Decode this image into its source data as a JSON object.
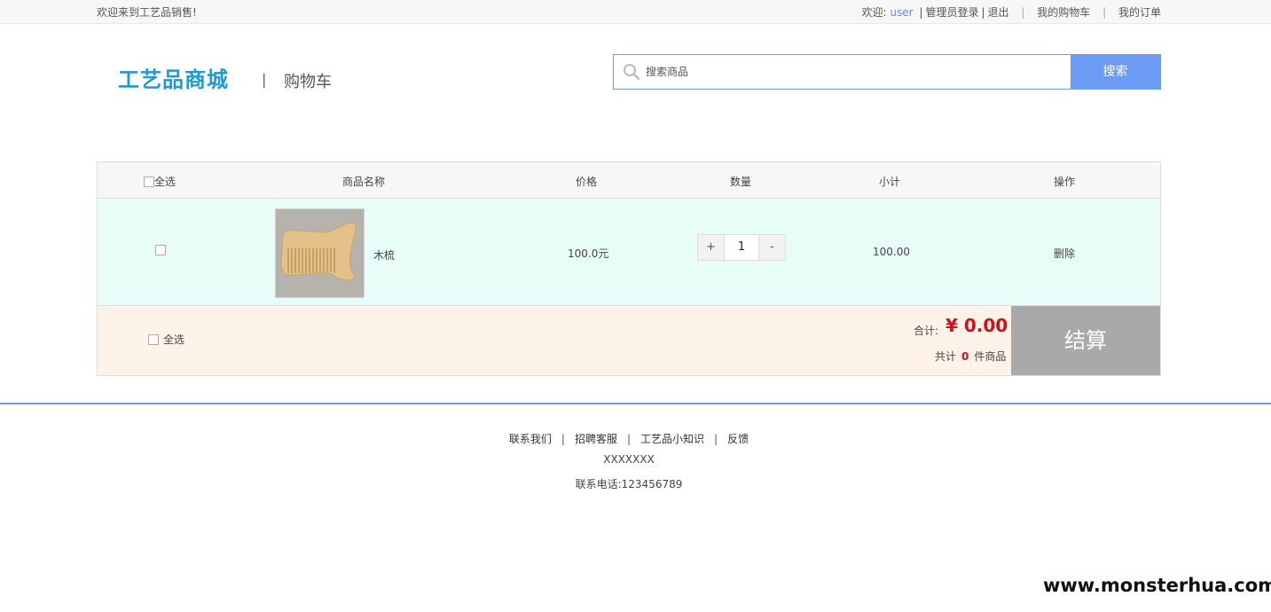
{
  "topbar": {
    "welcome": "欢迎来到工艺品销售!",
    "greeting": "欢迎:",
    "username": "user",
    "admin_login": "管理员登录",
    "logout": "退出",
    "my_cart": "我的购物车",
    "my_orders": "我的订单"
  },
  "header": {
    "logo": "工艺品商城",
    "separator": "|",
    "page_name": "购物车"
  },
  "search": {
    "placeholder": "搜索商品",
    "button_label": "搜索",
    "icon": "search-icon"
  },
  "cart": {
    "headers": {
      "select_all": "全选",
      "name": "商品名称",
      "price": "价格",
      "quantity": "数量",
      "subtotal": "小计",
      "action": "操作"
    },
    "items": [
      {
        "name": "木梳",
        "price": "100.0元",
        "quantity": "1",
        "subtotal": "100.00",
        "action": "删除",
        "plus": "+",
        "minus": "-"
      }
    ],
    "footer": {
      "select_all": "全选",
      "total_label": "合计:",
      "total_value": "¥ 0.00",
      "count_prefix": "共计",
      "count_value": "0",
      "count_suffix": "件商品",
      "checkout": "结算"
    }
  },
  "footer": {
    "links": [
      "联系我们",
      "招聘客服",
      "工艺品小知识",
      "反馈"
    ],
    "address": "XXXXXXX",
    "phone": "联系电话:123456789"
  },
  "watermark": "www.monsterhua.com",
  "colors": {
    "brand": "#1e9ad6",
    "search_button": "#6b9bf5",
    "row_bg": "#e9fdf8",
    "footer_bg": "#fdf3e9",
    "price_red": "#d0111b",
    "checkout_bg": "#a9a9a9"
  }
}
